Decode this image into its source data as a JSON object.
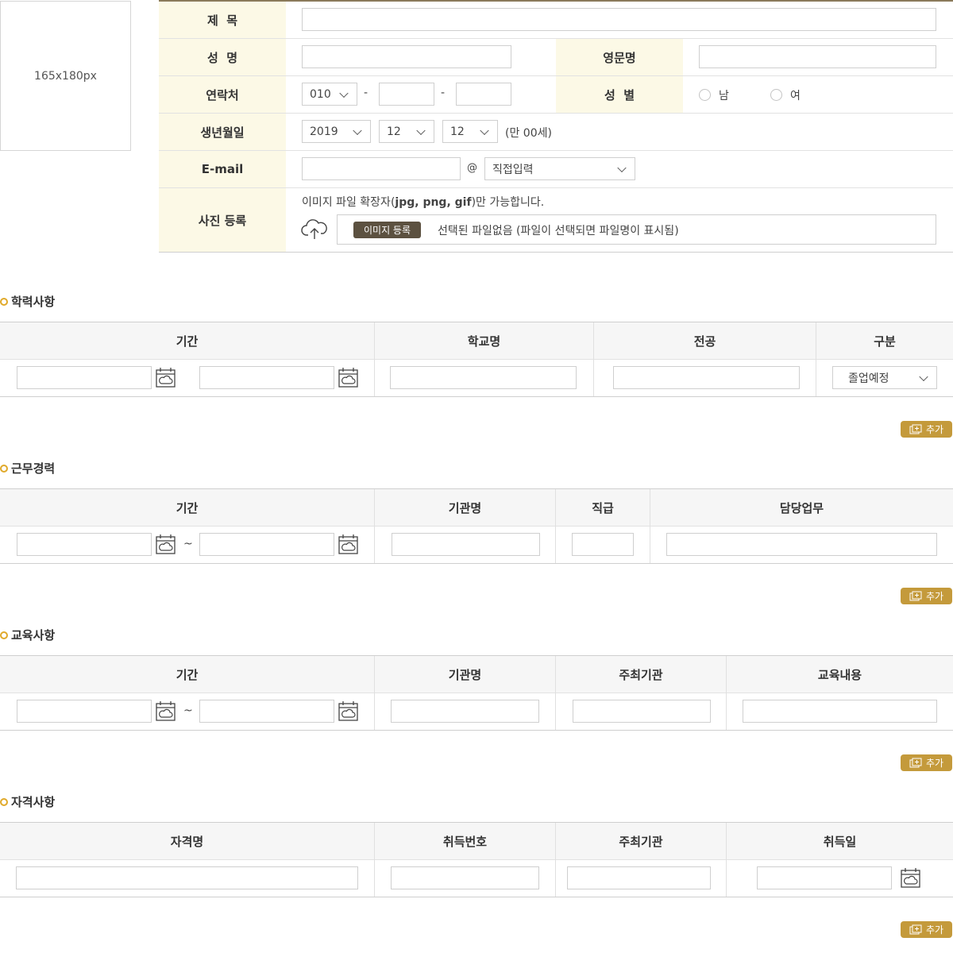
{
  "photo": {
    "placeholder": "165x180px"
  },
  "form": {
    "title_label": "제  목",
    "name_label": "성  명",
    "english_name_label": "영문명",
    "contact_label": "연락처",
    "phone_prefix": "010",
    "phone_dash": "-",
    "gender_label": "성  별",
    "gender_male": "남",
    "gender_female": "여",
    "birth_label": "생년월일",
    "birth_year": "2019",
    "birth_month": "12",
    "birth_day": "12",
    "age_text": "(만 00세)",
    "email_label": "E-mail",
    "email_at": "@",
    "email_domain": "직접입력",
    "photo_label": "사진 등록",
    "photo_notice_prefix": "이미지 파일 확장자(",
    "photo_notice_ext": "jpg, png, gif",
    "photo_notice_suffix": ")만 가능합니다.",
    "photo_button": "이미지 등록",
    "photo_file_status": "선택된 파일없음 (파일이 선택되면 파일명이 표시됨)"
  },
  "education": {
    "title": "학력사항",
    "headers": [
      "기간",
      "학교명",
      "전공",
      "구분"
    ],
    "status_select": "졸업예정",
    "add_label": "추가"
  },
  "career": {
    "title": "근무경력",
    "headers": [
      "기간",
      "기관명",
      "직급",
      "담당업무"
    ],
    "tilde": "~",
    "add_label": "추가"
  },
  "training": {
    "title": "교육사항",
    "headers": [
      "기간",
      "기관명",
      "주최기관",
      "교육내용"
    ],
    "tilde": "~",
    "add_label": "추가"
  },
  "license": {
    "title": "자격사항",
    "headers": [
      "자격명",
      "취득번호",
      "주최기관",
      "취득일"
    ],
    "add_label": "추가"
  },
  "colors": {
    "accent": "#c49a3b",
    "label_bg": "#fcf9e6",
    "bullet": "#e0a92a",
    "button_dark": "#5c5140"
  }
}
